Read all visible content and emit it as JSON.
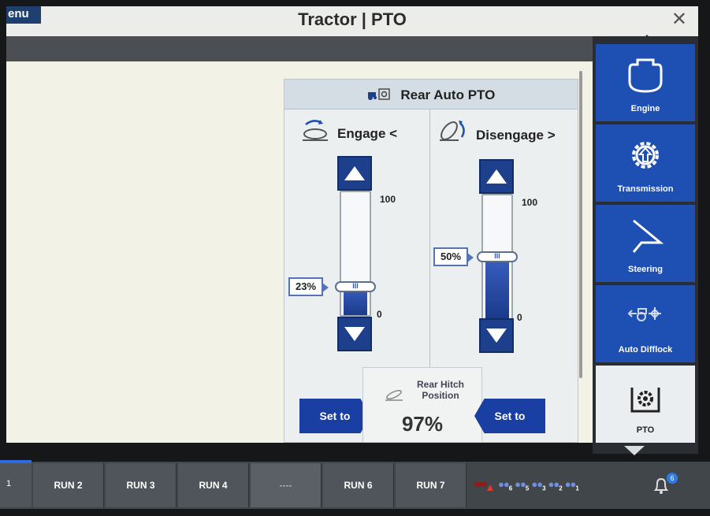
{
  "header": {
    "menu_label": "enu",
    "title": "Tractor | PTO",
    "close_glyph": "✕"
  },
  "pto": {
    "title": "Rear Auto PTO",
    "engage": {
      "label": "Engage <",
      "value_label": "23%",
      "level": 0.23,
      "max_label": "100",
      "min_label": "0"
    },
    "disengage": {
      "label": "Disengage >",
      "value_label": "50%",
      "level": 0.5,
      "max_label": "100",
      "min_label": "0"
    },
    "set_to_left": "Set to",
    "set_to_right": "Set to",
    "hitch": {
      "label": "Rear Hitch Position",
      "value": "97%"
    }
  },
  "sidebar": {
    "items": [
      {
        "label": "Engine",
        "icon": "engine-icon"
      },
      {
        "label": "Transmission",
        "icon": "transmission-gear-icon"
      },
      {
        "label": "Steering",
        "icon": "steering-icon"
      },
      {
        "label": "Auto Difflock",
        "icon": "difflock-icon"
      },
      {
        "label": "PTO",
        "icon": "pto-icon",
        "active": true
      }
    ]
  },
  "bottom": {
    "first_label": "1",
    "runs": [
      "RUN 2",
      "RUN 3",
      "RUN 4",
      "----",
      "RUN 6",
      "RUN 7"
    ],
    "tractor_counts": [
      "6",
      "5",
      "3",
      "2",
      "1"
    ],
    "notification_count": "6"
  },
  "colors": {
    "accent": "#1e4fb2",
    "button": "#1a3fa3",
    "fill": "#1b3a8a"
  }
}
